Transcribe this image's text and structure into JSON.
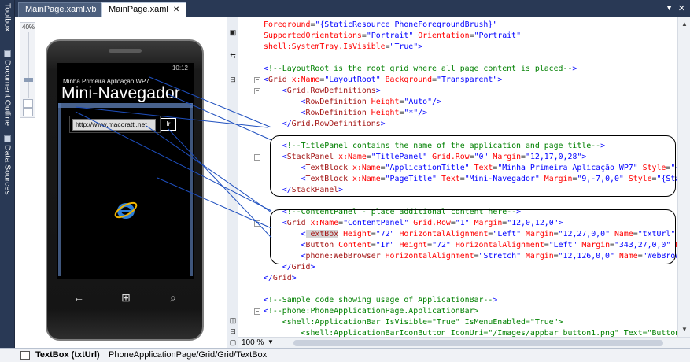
{
  "tabs": [
    {
      "label": "MainPage.xaml.vb",
      "active": false
    },
    {
      "label": "MainPage.xaml",
      "active": true
    }
  ],
  "side_panels": [
    "Toolbox",
    "Document Outline",
    "Data Sources"
  ],
  "designer": {
    "zoom_percent": "40%",
    "phone": {
      "status_time": "10:12",
      "app_title": "Minha Primeira Aplicação WP7",
      "page_title": "Mini-Navegador",
      "url_text": "http://www.macoratti.net",
      "go_button": "Ir"
    }
  },
  "editor": {
    "zoom": "100 %",
    "lines": [
      [
        {
          "c": "a",
          "t": "Foreground"
        },
        {
          "c": "k",
          "t": "="
        },
        {
          "c": "v",
          "t": "\"{StaticResource PhoneForegroundBrush}\""
        }
      ],
      [
        {
          "c": "a",
          "t": "SupportedOrientations"
        },
        {
          "c": "k",
          "t": "="
        },
        {
          "c": "v",
          "t": "\"Portrait\""
        },
        {
          "c": "k",
          "t": " "
        },
        {
          "c": "a",
          "t": "Orientation"
        },
        {
          "c": "k",
          "t": "="
        },
        {
          "c": "v",
          "t": "\"Portrait\""
        }
      ],
      [
        {
          "c": "a",
          "t": "shell:SystemTray.IsVisible"
        },
        {
          "c": "k",
          "t": "="
        },
        {
          "c": "v",
          "t": "\"True\""
        },
        {
          "c": "p",
          "t": ">"
        }
      ],
      [],
      [
        {
          "c": "p",
          "t": "<"
        },
        {
          "c": "c",
          "t": "!--LayoutRoot is the root grid where all page content is placed--"
        },
        {
          "c": "p",
          "t": ">"
        }
      ],
      [
        {
          "c": "p",
          "t": "<"
        },
        {
          "c": "t",
          "t": "Grid"
        },
        {
          "c": "k",
          "t": " "
        },
        {
          "c": "a",
          "t": "x:Name"
        },
        {
          "c": "k",
          "t": "="
        },
        {
          "c": "v",
          "t": "\"LayoutRoot\""
        },
        {
          "c": "k",
          "t": " "
        },
        {
          "c": "a",
          "t": "Background"
        },
        {
          "c": "k",
          "t": "="
        },
        {
          "c": "v",
          "t": "\"Transparent\""
        },
        {
          "c": "p",
          "t": ">"
        }
      ],
      [
        {
          "c": "k",
          "t": "    "
        },
        {
          "c": "p",
          "t": "<"
        },
        {
          "c": "t",
          "t": "Grid.RowDefinitions"
        },
        {
          "c": "p",
          "t": ">"
        }
      ],
      [
        {
          "c": "k",
          "t": "        "
        },
        {
          "c": "p",
          "t": "<"
        },
        {
          "c": "t",
          "t": "RowDefinition"
        },
        {
          "c": "k",
          "t": " "
        },
        {
          "c": "a",
          "t": "Height"
        },
        {
          "c": "k",
          "t": "="
        },
        {
          "c": "v",
          "t": "\"Auto\""
        },
        {
          "c": "p",
          "t": "/>"
        }
      ],
      [
        {
          "c": "k",
          "t": "        "
        },
        {
          "c": "p",
          "t": "<"
        },
        {
          "c": "t",
          "t": "RowDefinition"
        },
        {
          "c": "k",
          "t": " "
        },
        {
          "c": "a",
          "t": "Height"
        },
        {
          "c": "k",
          "t": "="
        },
        {
          "c": "v",
          "t": "\"*\""
        },
        {
          "c": "p",
          "t": "/>"
        }
      ],
      [
        {
          "c": "k",
          "t": "    "
        },
        {
          "c": "p",
          "t": "</"
        },
        {
          "c": "t",
          "t": "Grid.RowDefinitions"
        },
        {
          "c": "p",
          "t": ">"
        }
      ],
      [],
      [
        {
          "c": "k",
          "t": "    "
        },
        {
          "c": "p",
          "t": "<"
        },
        {
          "c": "c",
          "t": "!--TitlePanel contains the name of the application and page title--"
        },
        {
          "c": "p",
          "t": ">"
        }
      ],
      [
        {
          "c": "k",
          "t": "    "
        },
        {
          "c": "p",
          "t": "<"
        },
        {
          "c": "t",
          "t": "StackPanel"
        },
        {
          "c": "k",
          "t": " "
        },
        {
          "c": "a",
          "t": "x:Name"
        },
        {
          "c": "k",
          "t": "="
        },
        {
          "c": "v",
          "t": "\"TitlePanel\""
        },
        {
          "c": "k",
          "t": " "
        },
        {
          "c": "a",
          "t": "Grid.Row"
        },
        {
          "c": "k",
          "t": "="
        },
        {
          "c": "v",
          "t": "\"0\""
        },
        {
          "c": "k",
          "t": " "
        },
        {
          "c": "a",
          "t": "Margin"
        },
        {
          "c": "k",
          "t": "="
        },
        {
          "c": "v",
          "t": "\"12,17,0,28\""
        },
        {
          "c": "p",
          "t": ">"
        }
      ],
      [
        {
          "c": "k",
          "t": "        "
        },
        {
          "c": "p",
          "t": "<"
        },
        {
          "c": "t",
          "t": "TextBlock"
        },
        {
          "c": "k",
          "t": " "
        },
        {
          "c": "a",
          "t": "x:Name"
        },
        {
          "c": "k",
          "t": "="
        },
        {
          "c": "v",
          "t": "\"ApplicationTitle\""
        },
        {
          "c": "k",
          "t": " "
        },
        {
          "c": "a",
          "t": "Text"
        },
        {
          "c": "k",
          "t": "="
        },
        {
          "c": "v",
          "t": "\"Minha Primeira Aplicação WP7\""
        },
        {
          "c": "k",
          "t": " "
        },
        {
          "c": "a",
          "t": "Style"
        },
        {
          "c": "k",
          "t": "="
        },
        {
          "c": "v",
          "t": "\"{St"
        }
      ],
      [
        {
          "c": "k",
          "t": "        "
        },
        {
          "c": "p",
          "t": "<"
        },
        {
          "c": "t",
          "t": "TextBlock"
        },
        {
          "c": "k",
          "t": " "
        },
        {
          "c": "a",
          "t": "x:Name"
        },
        {
          "c": "k",
          "t": "="
        },
        {
          "c": "v",
          "t": "\"PageTitle\""
        },
        {
          "c": "k",
          "t": " "
        },
        {
          "c": "a",
          "t": "Text"
        },
        {
          "c": "k",
          "t": "="
        },
        {
          "c": "v",
          "t": "\"Mini-Navegador\""
        },
        {
          "c": "k",
          "t": " "
        },
        {
          "c": "a",
          "t": "Margin"
        },
        {
          "c": "k",
          "t": "="
        },
        {
          "c": "v",
          "t": "\"9,-7,0,0\""
        },
        {
          "c": "k",
          "t": " "
        },
        {
          "c": "a",
          "t": "Style"
        },
        {
          "c": "k",
          "t": "="
        },
        {
          "c": "v",
          "t": "\"{Sta"
        }
      ],
      [
        {
          "c": "k",
          "t": "    "
        },
        {
          "c": "p",
          "t": "</"
        },
        {
          "c": "t",
          "t": "StackPanel"
        },
        {
          "c": "p",
          "t": ">"
        }
      ],
      [],
      [
        {
          "c": "k",
          "t": "    "
        },
        {
          "c": "p",
          "t": "<"
        },
        {
          "c": "c",
          "t": "!--ContentPanel - place additional content here--"
        },
        {
          "c": "p",
          "t": ">"
        }
      ],
      [
        {
          "c": "k",
          "t": "    "
        },
        {
          "c": "p",
          "t": "<"
        },
        {
          "c": "t",
          "t": "Grid"
        },
        {
          "c": "k",
          "t": " "
        },
        {
          "c": "a",
          "t": "x:Name"
        },
        {
          "c": "k",
          "t": "="
        },
        {
          "c": "v",
          "t": "\"ContentPanel\""
        },
        {
          "c": "k",
          "t": " "
        },
        {
          "c": "a",
          "t": "Grid.Row"
        },
        {
          "c": "k",
          "t": "="
        },
        {
          "c": "v",
          "t": "\"1\""
        },
        {
          "c": "k",
          "t": " "
        },
        {
          "c": "a",
          "t": "Margin"
        },
        {
          "c": "k",
          "t": "="
        },
        {
          "c": "v",
          "t": "\"12,0,12,0\""
        },
        {
          "c": "p",
          "t": ">"
        }
      ],
      [
        {
          "c": "k",
          "t": "        "
        },
        {
          "c": "p",
          "t": "<"
        },
        {
          "c": "t",
          "t": "TextBox",
          "hl": true
        },
        {
          "c": "k",
          "t": " "
        },
        {
          "c": "a",
          "t": "Height"
        },
        {
          "c": "k",
          "t": "="
        },
        {
          "c": "v",
          "t": "\"72\""
        },
        {
          "c": "k",
          "t": " "
        },
        {
          "c": "a",
          "t": "HorizontalAlignment"
        },
        {
          "c": "k",
          "t": "="
        },
        {
          "c": "v",
          "t": "\"Left\""
        },
        {
          "c": "k",
          "t": " "
        },
        {
          "c": "a",
          "t": "Margin"
        },
        {
          "c": "k",
          "t": "="
        },
        {
          "c": "v",
          "t": "\"12,27,0,0\""
        },
        {
          "c": "k",
          "t": " "
        },
        {
          "c": "a",
          "t": "Name"
        },
        {
          "c": "k",
          "t": "="
        },
        {
          "c": "v",
          "t": "\"txtUrl\""
        }
      ],
      [
        {
          "c": "k",
          "t": "        "
        },
        {
          "c": "p",
          "t": "<"
        },
        {
          "c": "t",
          "t": "Button"
        },
        {
          "c": "k",
          "t": " "
        },
        {
          "c": "a",
          "t": "Content"
        },
        {
          "c": "k",
          "t": "="
        },
        {
          "c": "v",
          "t": "\"Ir\""
        },
        {
          "c": "k",
          "t": " "
        },
        {
          "c": "a",
          "t": "Height"
        },
        {
          "c": "k",
          "t": "="
        },
        {
          "c": "v",
          "t": "\"72\""
        },
        {
          "c": "k",
          "t": " "
        },
        {
          "c": "a",
          "t": "HorizontalAlignment"
        },
        {
          "c": "k",
          "t": "="
        },
        {
          "c": "v",
          "t": "\"Left\""
        },
        {
          "c": "k",
          "t": " "
        },
        {
          "c": "a",
          "t": "Margin"
        },
        {
          "c": "k",
          "t": "="
        },
        {
          "c": "v",
          "t": "\"343,27,0,0\""
        },
        {
          "c": "k",
          "t": " "
        },
        {
          "c": "a",
          "t": "N"
        }
      ],
      [
        {
          "c": "k",
          "t": "        "
        },
        {
          "c": "p",
          "t": "<"
        },
        {
          "c": "t",
          "t": "phone:WebBrowser"
        },
        {
          "c": "k",
          "t": " "
        },
        {
          "c": "a",
          "t": "HorizontalAlignment"
        },
        {
          "c": "k",
          "t": "="
        },
        {
          "c": "v",
          "t": "\"Stretch\""
        },
        {
          "c": "k",
          "t": " "
        },
        {
          "c": "a",
          "t": "Margin"
        },
        {
          "c": "k",
          "t": "="
        },
        {
          "c": "v",
          "t": "\"12,126,0,0\""
        },
        {
          "c": "k",
          "t": " "
        },
        {
          "c": "a",
          "t": "Name"
        },
        {
          "c": "k",
          "t": "="
        },
        {
          "c": "v",
          "t": "\"WebBrow"
        }
      ],
      [
        {
          "c": "k",
          "t": "    "
        },
        {
          "c": "p",
          "t": "</"
        },
        {
          "c": "t",
          "t": "Grid"
        },
        {
          "c": "p",
          "t": ">"
        }
      ],
      [
        {
          "c": "p",
          "t": "</"
        },
        {
          "c": "t",
          "t": "Grid"
        },
        {
          "c": "p",
          "t": ">"
        }
      ],
      [],
      [
        {
          "c": "p",
          "t": "<"
        },
        {
          "c": "c",
          "t": "!--Sample code showing usage of ApplicationBar--"
        },
        {
          "c": "p",
          "t": ">"
        }
      ],
      [
        {
          "c": "p",
          "t": "<"
        },
        {
          "c": "c",
          "t": "!--phone:PhoneApplicationPage.ApplicationBar>"
        }
      ],
      [
        {
          "c": "c",
          "t": "    <shell:ApplicationBar IsVisible=\"True\" IsMenuEnabled=\"True\">"
        }
      ],
      [
        {
          "c": "c",
          "t": "        <shell:ApplicationBarIconButton IconUri=\"/Images/appbar_button1.png\" Text=\"Button"
        }
      ],
      [
        {
          "c": "c",
          "t": "        <shell:ApplicationBarIconButton IconUri=\"/Images/appbar_button2.png\" Text=\"Button"
        }
      ]
    ]
  },
  "status": {
    "element": "TextBox (txtUrl)",
    "path": "PhoneApplicationPage/Grid/Grid/TextBox"
  },
  "colors": {
    "chrome": "#293955",
    "tag": "#a31515",
    "attribute": "#ff0000",
    "value": "#0000ff",
    "comment": "#008000",
    "selection": "#5a7ab0"
  }
}
